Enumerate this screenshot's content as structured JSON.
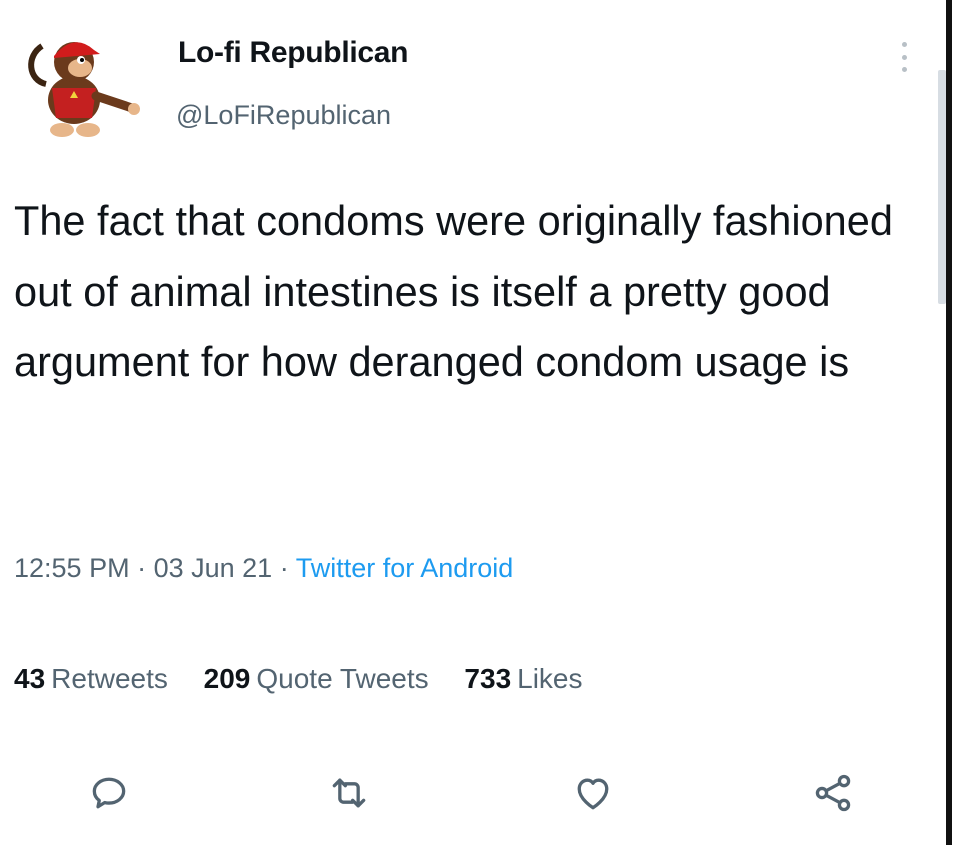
{
  "author": {
    "name": "Lo-fi Republican",
    "handle": "@LoFiRepublican",
    "avatar_icon": "monkey-avatar-icon"
  },
  "tweet": {
    "text": "The fact that condoms were originally fashioned out of animal intestines is itself a pretty good argument for how deranged condom usage is"
  },
  "meta": {
    "time": "12:55 PM",
    "separator1": " · ",
    "date": "03 Jun 21",
    "separator2": " · ",
    "source": "Twitter for Android"
  },
  "stats": {
    "retweets_count": "43",
    "retweets_label": "Retweets",
    "quotes_count": "209",
    "quotes_label": "Quote Tweets",
    "likes_count": "733",
    "likes_label": "Likes"
  },
  "actions": {
    "reply_icon": "reply-icon",
    "retweet_icon": "retweet-icon",
    "like_icon": "heart-icon",
    "share_icon": "share-icon"
  },
  "colors": {
    "text": "#0f1419",
    "secondary": "#536471",
    "link": "#1d9bf0"
  }
}
